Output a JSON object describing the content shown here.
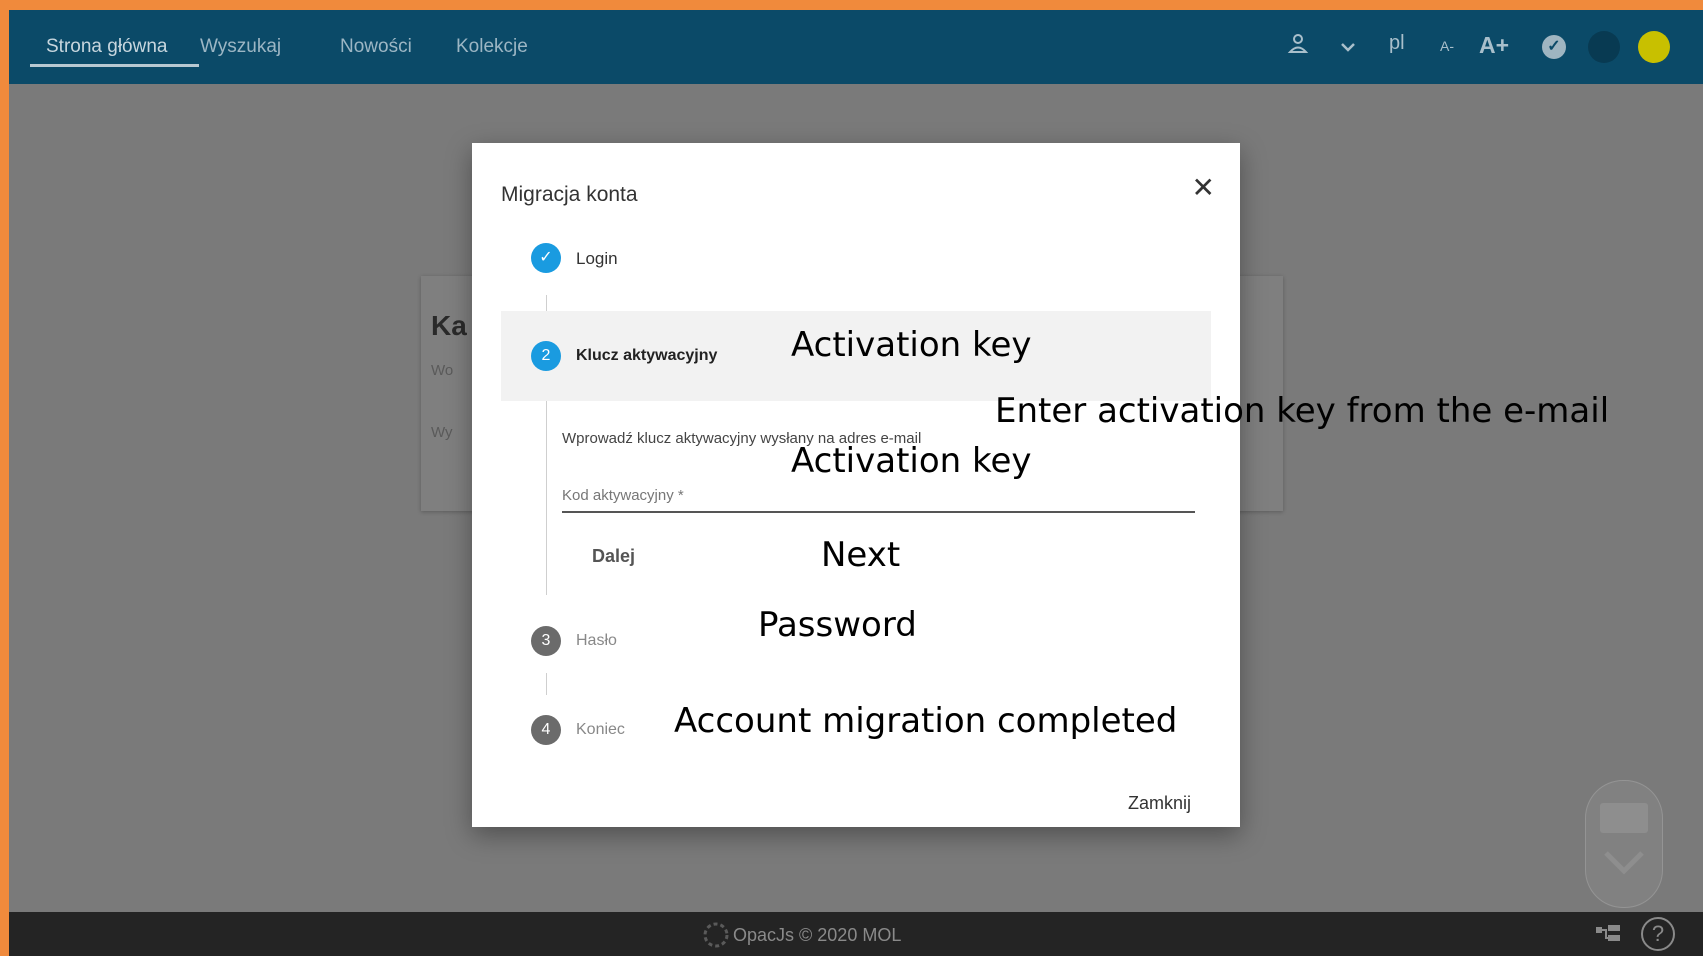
{
  "nav": {
    "items": [
      "Strona główna",
      "Wyszukaj",
      "Nowości",
      "Kolekcje"
    ],
    "lang": "pl",
    "font_smaller": "A-",
    "font_larger": "A+",
    "icons": [
      "user-icon",
      "chevron-down-icon",
      "check-circle-icon",
      "contrast-dark-icon",
      "contrast-yellow-icon"
    ],
    "colors": {
      "bar": "#0b4a68",
      "yellow": "#c8c000"
    }
  },
  "background_card": {
    "title": "Ka",
    "field1": "Wo",
    "field2": "Wy"
  },
  "modal": {
    "title": "Migracja konta",
    "steps": [
      {
        "number": "✓",
        "label": "Login",
        "state": "done"
      },
      {
        "number": "2",
        "label": "Klucz aktywacyjny",
        "state": "active",
        "annotation": "Activation key"
      },
      {
        "number": "3",
        "label": "Hasło",
        "state": "pending",
        "annotation": "Password"
      },
      {
        "number": "4",
        "label": "Koniec",
        "state": "pending",
        "annotation": "Account migration completed"
      }
    ],
    "instruction": "Wprowadź klucz aktywacyjny wysłany na adres e-mail",
    "instruction_annotation": "Enter activation key from the e-mail",
    "field_placeholder": "Kod aktywacyjny *",
    "field_annotation": "Activation key",
    "next_button": "Dalej",
    "next_annotation": "Next",
    "close_button": "Zamknij",
    "colors": {
      "accent": "#1a9be0",
      "pending": "#6b6b6b"
    }
  },
  "footer": {
    "text": "OpacJs © 2020 MOL"
  }
}
